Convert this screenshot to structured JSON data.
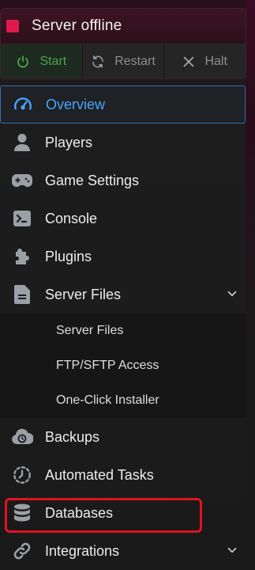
{
  "status": {
    "label": "Server offline",
    "indicator_color": "#e0194f"
  },
  "power": {
    "start_label": "Start",
    "restart_label": "Restart",
    "halt_label": "Halt"
  },
  "nav": {
    "items": [
      {
        "label": "Overview",
        "icon": "gauge-icon",
        "active": true
      },
      {
        "label": "Players",
        "icon": "user-icon"
      },
      {
        "label": "Game Settings",
        "icon": "gamepad-icon"
      },
      {
        "label": "Console",
        "icon": "terminal-icon"
      },
      {
        "label": "Plugins",
        "icon": "puzzle-icon"
      },
      {
        "label": "Server Files",
        "icon": "file-icon",
        "expanded": true
      },
      {
        "label": "Backups",
        "icon": "cloud-backup-icon"
      },
      {
        "label": "Automated Tasks",
        "icon": "clock-dashed-icon"
      },
      {
        "label": "Databases",
        "icon": "database-icon",
        "highlighted": true
      },
      {
        "label": "Integrations",
        "icon": "link-icon"
      }
    ],
    "server_files_sub": [
      {
        "label": "Server Files"
      },
      {
        "label": "FTP/SFTP Access"
      },
      {
        "label": "One-Click Installer"
      }
    ]
  },
  "colors": {
    "accent": "#4aa3ff",
    "start_green": "#4ca64c",
    "highlight_red": "#e0141e"
  }
}
